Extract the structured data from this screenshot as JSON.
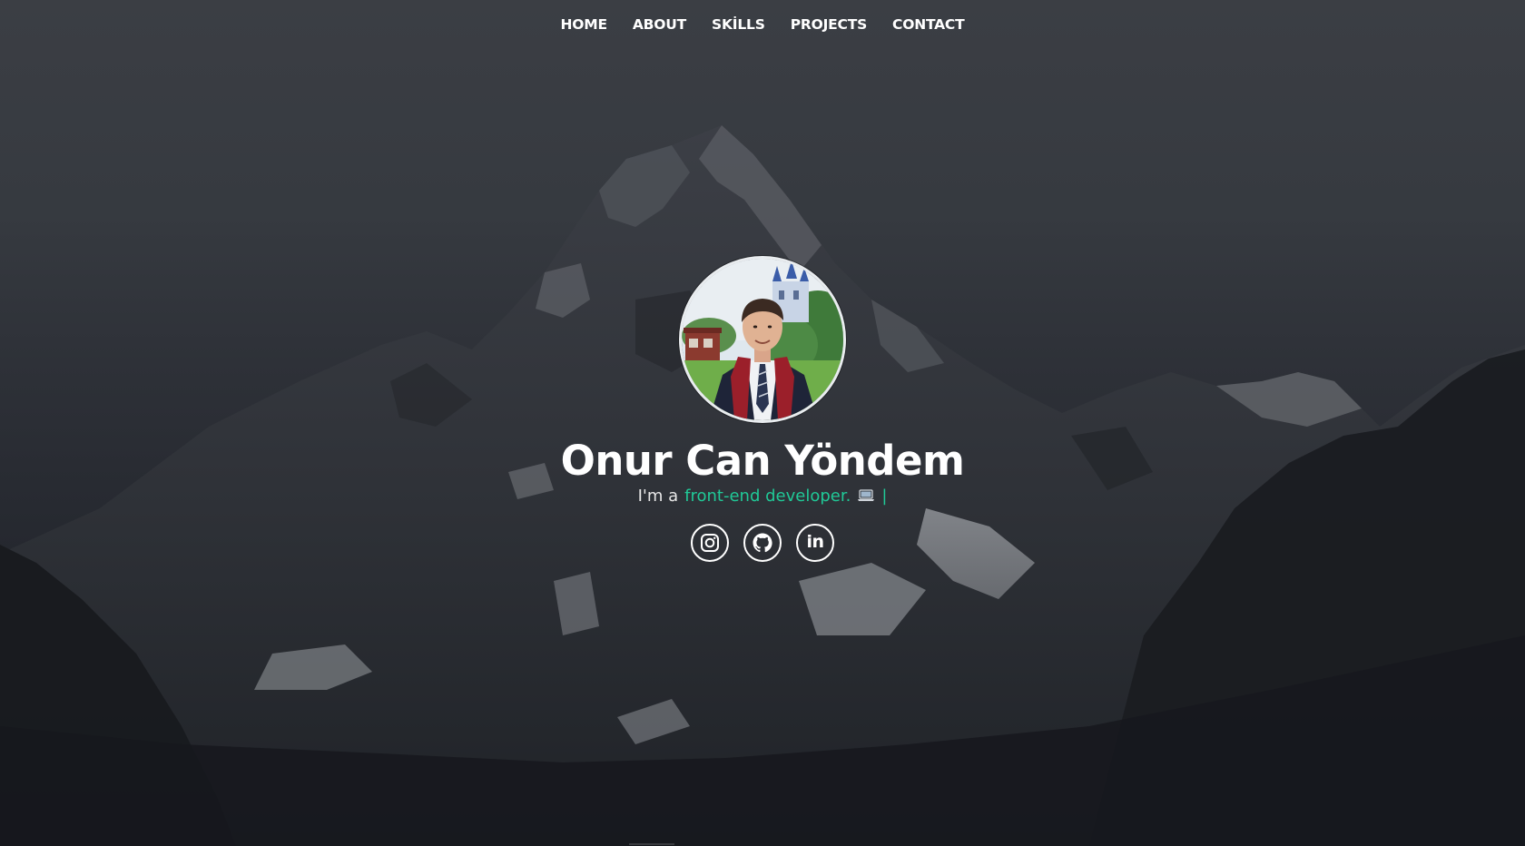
{
  "nav": {
    "items": [
      {
        "label": "HOME"
      },
      {
        "label": "ABOUT"
      },
      {
        "label": "SKİLLS"
      },
      {
        "label": "PROJECTS"
      },
      {
        "label": "CONTACT"
      }
    ]
  },
  "profile": {
    "name": "Onur Can Yöndem",
    "tagline_prefix": "I'm a",
    "tagline_role": "front-end developer.",
    "tagline_icon": "laptop-icon",
    "cursor": "|"
  },
  "socials": [
    {
      "name": "instagram-icon"
    },
    {
      "name": "github-icon"
    },
    {
      "name": "linkedin-icon",
      "text": "in"
    }
  ],
  "colors": {
    "accent": "#20c997",
    "text": "#ffffff",
    "background": "#2d3037"
  }
}
